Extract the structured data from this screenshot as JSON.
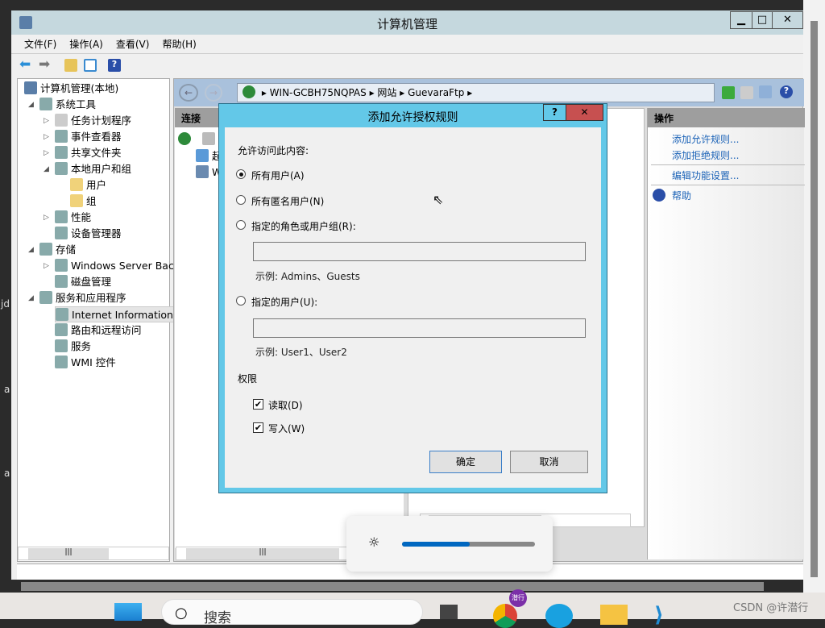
{
  "window": {
    "title": "计算机管理",
    "min": "▁",
    "max": "□",
    "close": "✕"
  },
  "menu": [
    "文件(F)",
    "操作(A)",
    "查看(V)",
    "帮助(H)"
  ],
  "tree": [
    {
      "label": "计算机管理(本地)",
      "icon": "computer-icon",
      "level": 0,
      "expander": ""
    },
    {
      "label": "系统工具",
      "icon": "tools-icon",
      "level": 1,
      "expander": "◢"
    },
    {
      "label": "任务计划程序",
      "icon": "clock-icon",
      "level": 2,
      "expander": "▷"
    },
    {
      "label": "事件查看器",
      "icon": "event-viewer-icon",
      "level": 2,
      "expander": "▷"
    },
    {
      "label": "共享文件夹",
      "icon": "shared-folder-icon",
      "level": 2,
      "expander": "▷"
    },
    {
      "label": "本地用户和组",
      "icon": "users-icon",
      "level": 2,
      "expander": "◢"
    },
    {
      "label": "用户",
      "icon": "folder-icon",
      "level": 3,
      "expander": ""
    },
    {
      "label": "组",
      "icon": "folder-icon",
      "level": 3,
      "expander": ""
    },
    {
      "label": "性能",
      "icon": "performance-icon",
      "level": 2,
      "expander": "▷"
    },
    {
      "label": "设备管理器",
      "icon": "device-manager-icon",
      "level": 2,
      "expander": ""
    },
    {
      "label": "存储",
      "icon": "storage-icon",
      "level": 1,
      "expander": "◢"
    },
    {
      "label": "Windows Server Back",
      "icon": "backup-icon",
      "level": 2,
      "expander": "▷"
    },
    {
      "label": "磁盘管理",
      "icon": "disk-icon",
      "level": 2,
      "expander": ""
    },
    {
      "label": "服务和应用程序",
      "icon": "services-apps-icon",
      "level": 1,
      "expander": "◢"
    },
    {
      "label": "Internet Information S",
      "icon": "iis-icon",
      "level": 2,
      "expander": "",
      "selected": true
    },
    {
      "label": "路由和远程访问",
      "icon": "routing-icon",
      "level": 2,
      "expander": ""
    },
    {
      "label": "服务",
      "icon": "gear-icon",
      "level": 2,
      "expander": ""
    },
    {
      "label": "WMI 控件",
      "icon": "wmi-icon",
      "level": 2,
      "expander": ""
    }
  ],
  "iis": {
    "breadcrumb": [
      "WIN-GCBH75NQPAS",
      "网站",
      "GuevaraFtp"
    ],
    "connections_title": "连接",
    "conn_items": [
      "起",
      "W"
    ],
    "actions_title": "操作",
    "actions": [
      "添加允许规则...",
      "添加拒绝规则...",
      "编辑功能设置...",
      "帮助"
    ]
  },
  "dialog": {
    "title": "添加允许授权规则",
    "help": "?",
    "close": "✕",
    "section_label": "允许访问此内容:",
    "options": [
      {
        "label": "所有用户(A)",
        "selected": true
      },
      {
        "label": "所有匿名用户(N)",
        "selected": false
      },
      {
        "label": "指定的角色或用户组(R):",
        "selected": false
      },
      {
        "label": "指定的用户(U):",
        "selected": false
      }
    ],
    "roles_value": "",
    "roles_example": "示例: Admins、Guests",
    "users_value": "",
    "users_example": "示例: User1、User2",
    "permissions_label": "权限",
    "permissions": [
      {
        "label": "读取(D)",
        "checked": true
      },
      {
        "label": "写入(W)",
        "checked": true
      }
    ],
    "ok": "确定",
    "cancel": "取消"
  },
  "brightness": {
    "percent": 51,
    "icon": "sun-icon"
  },
  "taskbar": {
    "search_placeholder": "搜索",
    "watermark": "CSDN @许潜行",
    "badge": "潜行"
  },
  "side_text": [
    "jd",
    "a",
    "a"
  ],
  "colors": {
    "titlebar": "#c5d8de",
    "dialog_frame": "#63c8e8",
    "close_red": "#c75050",
    "link": "#1c63b7",
    "accent": "#0067c0"
  }
}
